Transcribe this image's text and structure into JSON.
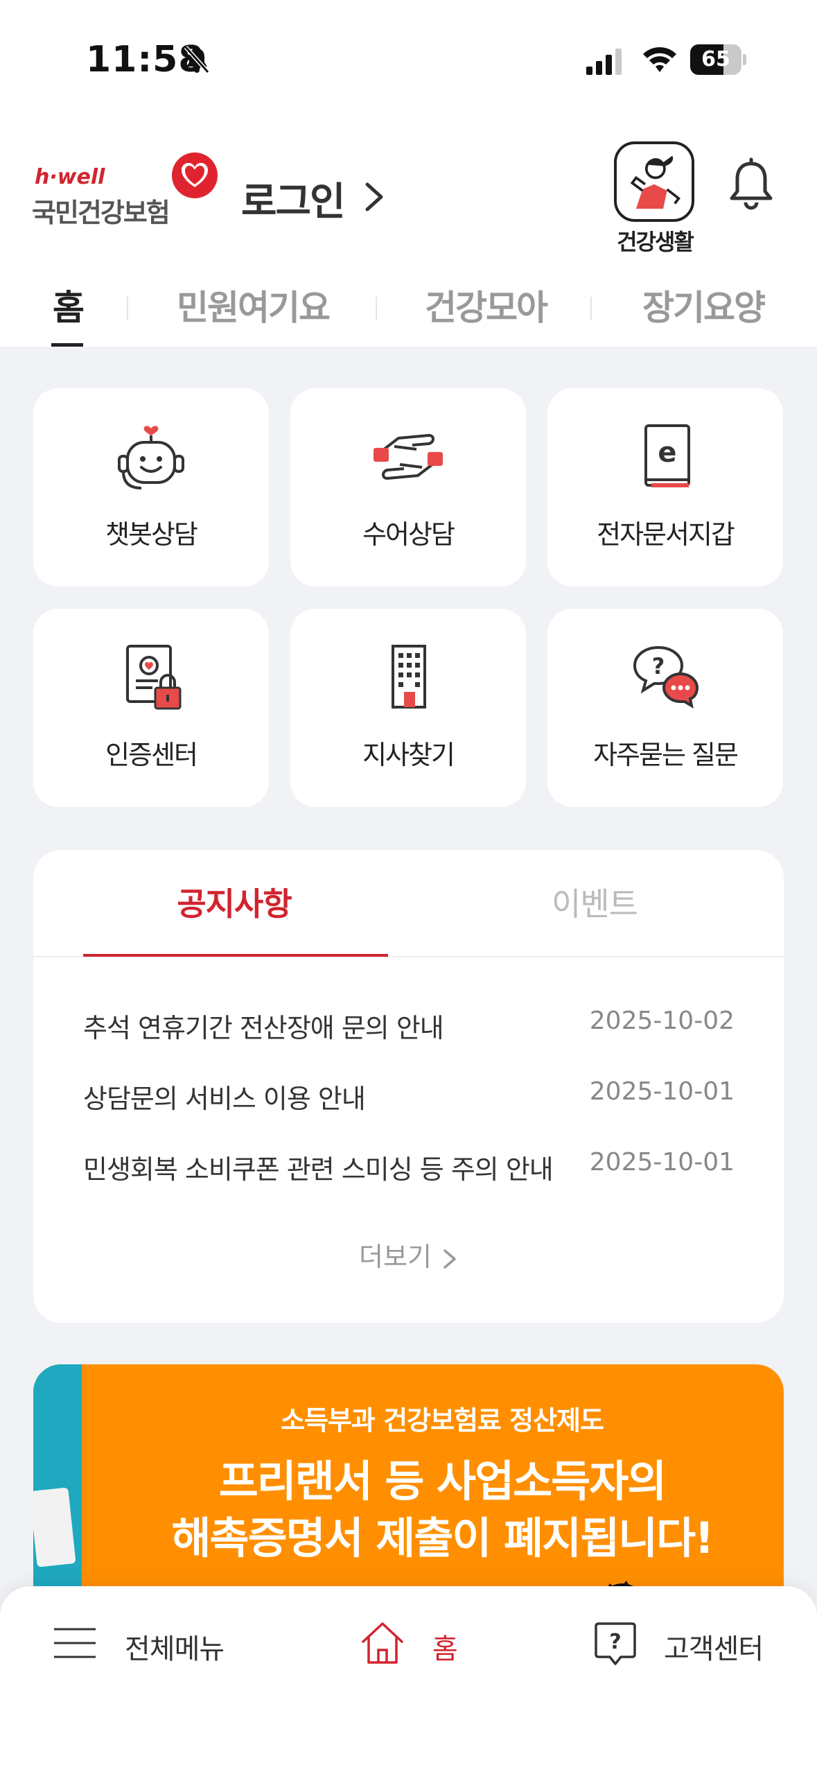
{
  "status_bar": {
    "time": "11:58",
    "battery_level": 65,
    "battery_text": "65"
  },
  "header": {
    "logo_tagline": "h·well",
    "logo_name": "국민건강보험",
    "login_label": "로그인",
    "health_life_label": "건강생활"
  },
  "tabs": [
    {
      "label": "홈",
      "active": true
    },
    {
      "label": "민원여기요",
      "active": false
    },
    {
      "label": "건강모아",
      "active": false
    },
    {
      "label": "장기요양",
      "active": false
    }
  ],
  "menu": [
    {
      "label": "챗봇상담",
      "icon": "chatbot-icon"
    },
    {
      "label": "수어상담",
      "icon": "sign-language-icon"
    },
    {
      "label": "전자문서지갑",
      "icon": "e-document-wallet-icon"
    },
    {
      "label": "인증센터",
      "icon": "certificate-lock-icon"
    },
    {
      "label": "지사찾기",
      "icon": "building-icon"
    },
    {
      "label": "자주묻는 질문",
      "icon": "faq-bubbles-icon"
    }
  ],
  "notice": {
    "tab_notice": "공지사항",
    "tab_event": "이벤트",
    "items": [
      {
        "title": "추석 연휴기간 전산장애 문의 안내",
        "date": "2025-10-02"
      },
      {
        "title": "상담문의 서비스 이용 안내",
        "date": "2025-10-01"
      },
      {
        "title": "민생회복 소비쿠폰 관련 스미싱 등 주의 안내",
        "date": "2025-10-01"
      }
    ],
    "more_label": "더보기"
  },
  "banner": {
    "subtitle": "소득부과 건강보험료 정산제도",
    "line1": "프리랜서 등 사업소득자의",
    "line2": "해촉증명서 제출이 폐지됩니다!"
  },
  "bottom_nav": {
    "menu_label": "전체메뉴",
    "home_label": "홈",
    "support_label": "고객센터"
  },
  "colors": {
    "accent": "#d1242f",
    "background": "#f0f2f6",
    "banner": "#ff8f00"
  }
}
